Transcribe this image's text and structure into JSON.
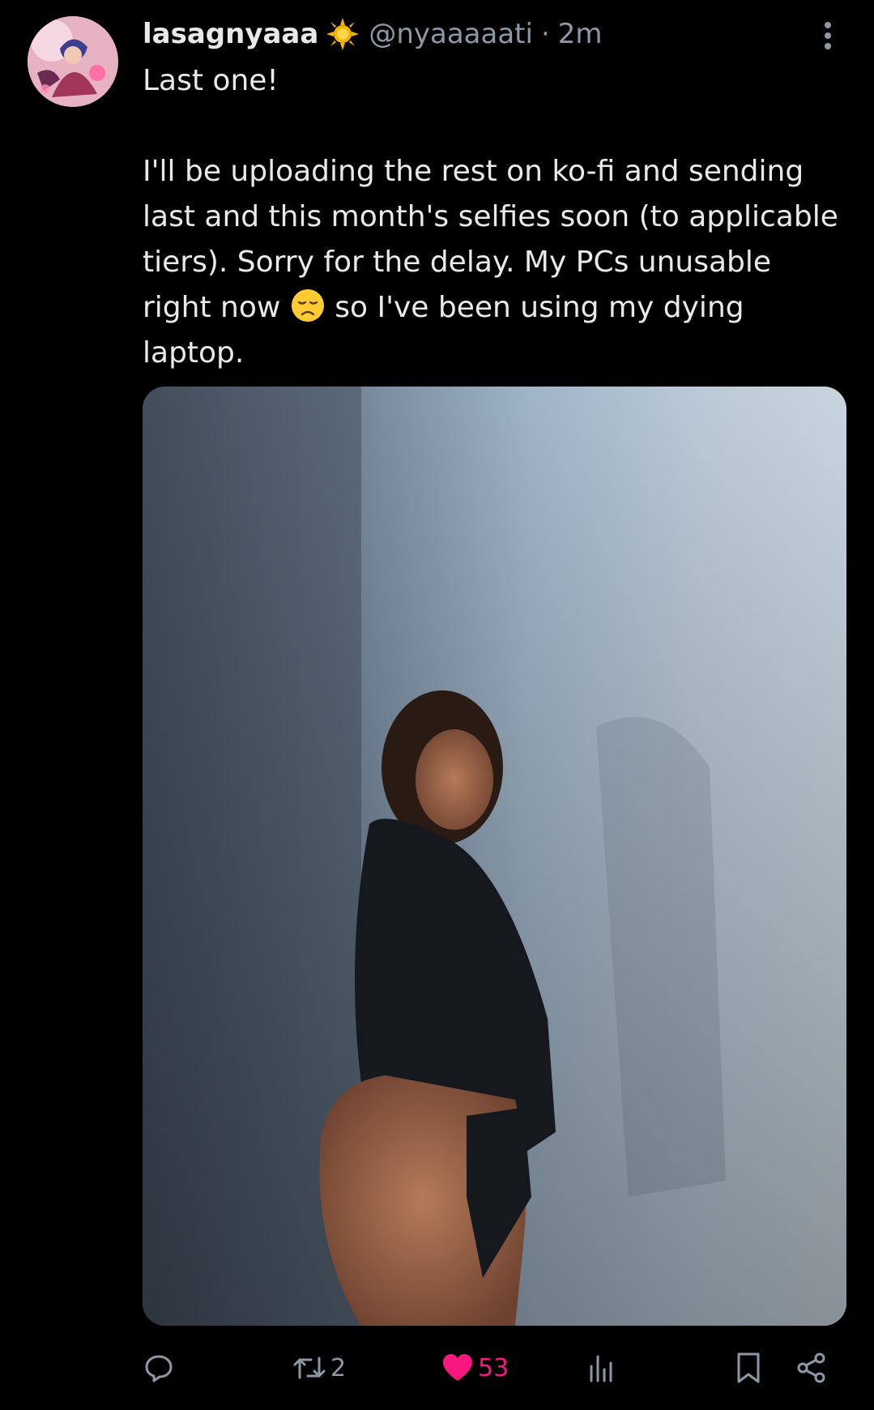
{
  "tweet": {
    "display_name": "lasagnyaaa",
    "handle": "@nyaaaaati",
    "separator": "·",
    "timestamp": "2m",
    "text_line_1": "Last one!",
    "text_para_2_a": "I'll be uploading the rest on ko-fi and sending last and this month's selfies soon (to applicable tiers). Sorry for the delay. My PCs unusable right now",
    "text_para_2_b": "so I've been using my dying laptop."
  },
  "icons": {
    "verified": "sun-badge-icon",
    "more": "more-vertical-icon",
    "emoji": "disappointed-face-emoji",
    "reply": "reply-icon",
    "retweet": "retweet-icon",
    "like": "heart-icon",
    "views": "views-icon",
    "bookmark": "bookmark-icon",
    "share": "share-icon"
  },
  "actions": {
    "reply_count": "",
    "retweet_count": "2",
    "like_count": "53",
    "views_count": ""
  },
  "colors": {
    "background": "#000000",
    "text": "#e7e9ea",
    "secondary": "#8b98a5",
    "like": "#f91880",
    "verified": "#f5b400"
  }
}
